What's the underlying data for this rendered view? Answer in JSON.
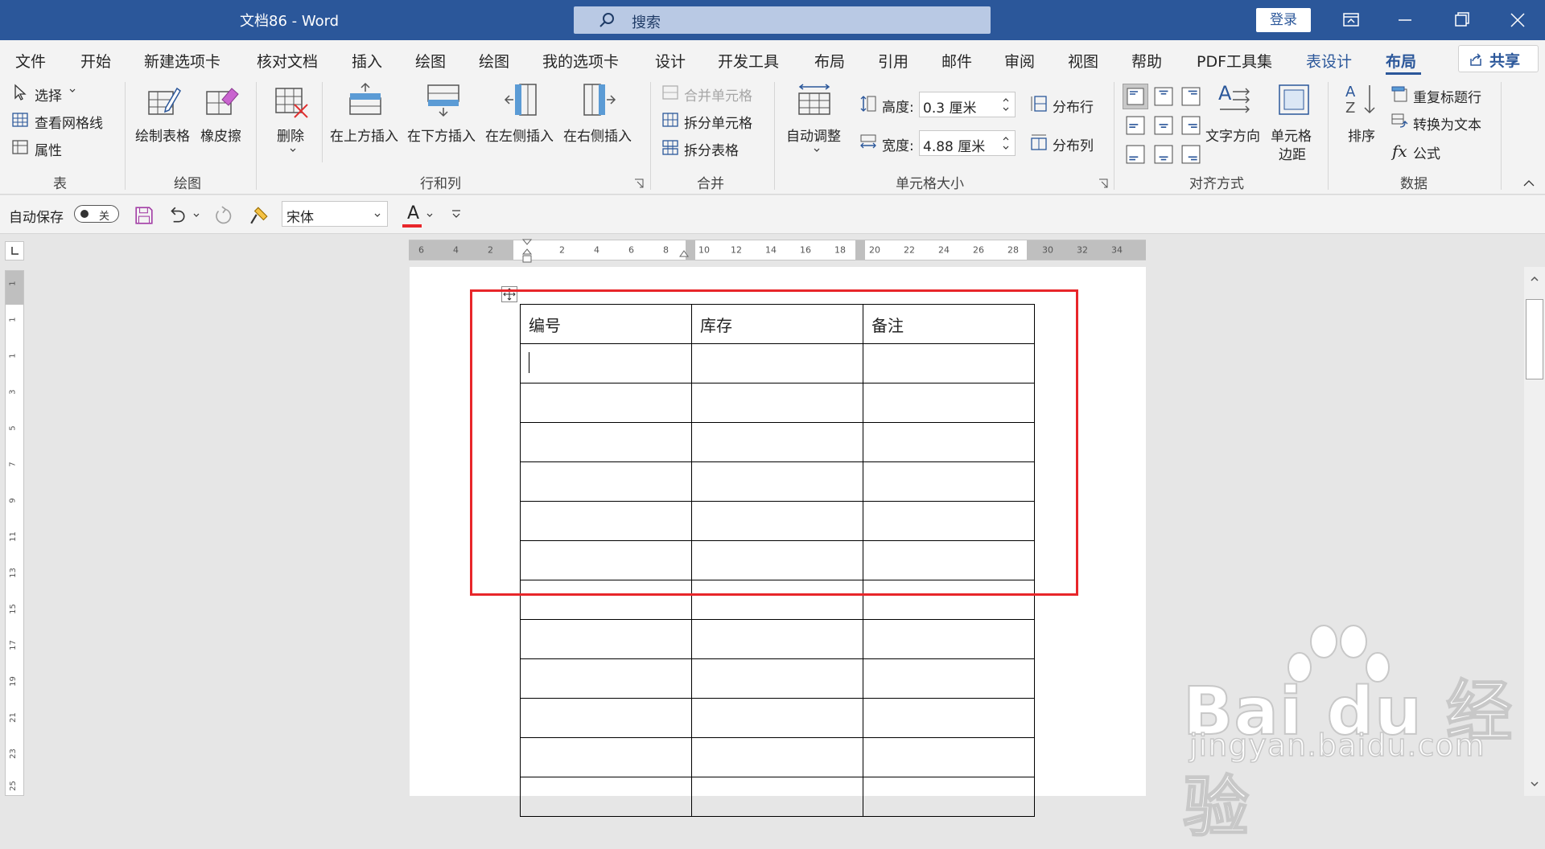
{
  "window": {
    "title": "文档86  -  Word",
    "login": "登录"
  },
  "search": {
    "placeholder": "搜索"
  },
  "menu": {
    "tabs": [
      "文件",
      "开始",
      "新建选项卡",
      "核对文档",
      "插入",
      "绘图",
      "绘图",
      "我的选项卡",
      "设计",
      "开发工具",
      "布局",
      "引用",
      "邮件",
      "审阅",
      "视图",
      "帮助",
      "PDF工具集",
      "表设计",
      "布局"
    ],
    "share": "共享"
  },
  "ribbon": {
    "table": {
      "select": "选择",
      "gridlines": "查看网格线",
      "properties": "属性",
      "label": "表"
    },
    "draw": {
      "draw_table": "绘制表格",
      "eraser": "橡皮擦",
      "label": "绘图"
    },
    "rows_cols": {
      "delete": "删除",
      "insert_above": "在上方插入",
      "insert_below": "在下方插入",
      "insert_left": "在左侧插入",
      "insert_right": "在右侧插入",
      "label": "行和列"
    },
    "merge": {
      "merge_cells": "合并单元格",
      "split_cells": "拆分单元格",
      "split_table": "拆分表格",
      "label": "合并"
    },
    "cell_size": {
      "autofit": "自动调整",
      "height_label": "高度:",
      "height_value": "0.3 厘米",
      "width_label": "宽度:",
      "width_value": "4.88 厘米",
      "dist_rows": "分布行",
      "dist_cols": "分布列",
      "label": "单元格大小"
    },
    "alignment": {
      "text_direction": "文字方向",
      "cell_margins_1": "单元格",
      "cell_margins_2": "边距",
      "label": "对齐方式"
    },
    "data": {
      "sort": "排序",
      "repeat_header": "重复标题行",
      "convert_text": "转换为文本",
      "formula": "公式",
      "label": "数据"
    }
  },
  "qat": {
    "autosave": "自动保存",
    "toggle": "关",
    "font": "宋体"
  },
  "ruler": {
    "h_labels": [
      "6",
      "4",
      "2",
      "2",
      "4",
      "6",
      "8",
      "10",
      "12",
      "14",
      "16",
      "18",
      "20",
      "22",
      "24",
      "26",
      "28",
      "30",
      "32",
      "34"
    ],
    "v_labels": [
      "1",
      "1",
      "1",
      "3",
      "5",
      "7",
      "9",
      "11",
      "13",
      "15",
      "17",
      "19",
      "21",
      "23",
      "25"
    ]
  },
  "document": {
    "table": {
      "header": [
        "编号",
        "库存",
        "备注"
      ],
      "empty_rows": 12
    }
  },
  "watermark": {
    "line1": "Bai du 经验",
    "line2": "jingyan.baidu.com"
  }
}
